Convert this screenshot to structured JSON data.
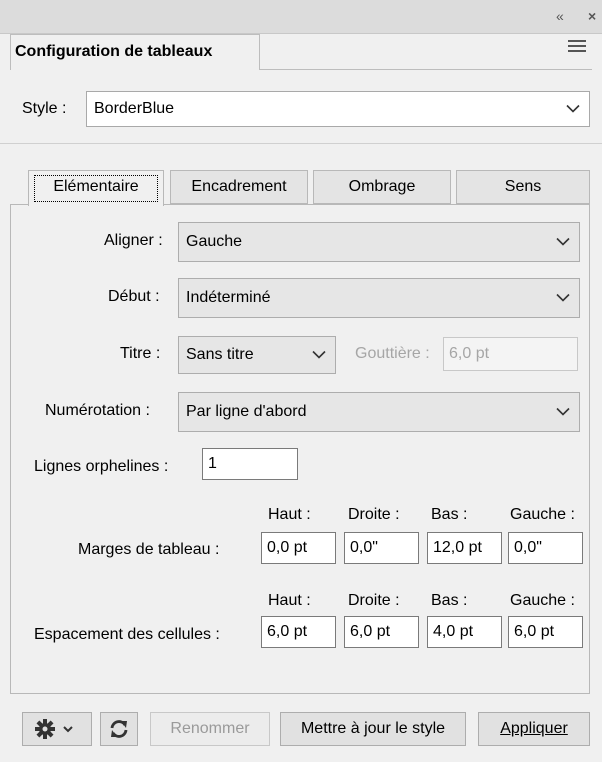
{
  "panel": {
    "title": "Configuration de tableaux"
  },
  "style_row": {
    "label": "Style :",
    "value": "BorderBlue"
  },
  "tabs": [
    {
      "label": "Elémentaire",
      "active": true
    },
    {
      "label": "Encadrement",
      "active": false
    },
    {
      "label": "Ombrage",
      "active": false
    },
    {
      "label": "Sens",
      "active": false
    }
  ],
  "fields": {
    "aligner": {
      "label": "Aligner :",
      "value": "Gauche"
    },
    "debut": {
      "label": "Début :",
      "value": "Indéterminé"
    },
    "titre": {
      "label": "Titre :",
      "value": "Sans titre"
    },
    "gouttiere": {
      "label": "Gouttière :",
      "value": "6,0 pt"
    },
    "numerotation": {
      "label": "Numérotation :",
      "value": "Par ligne d'abord"
    },
    "lignes_orphelines": {
      "label": "Lignes orphelines :",
      "value": "1"
    }
  },
  "margins": {
    "label": "Marges de tableau :",
    "headers": [
      "Haut :",
      "Droite :",
      "Bas :",
      "Gauche :"
    ],
    "values": [
      "0,0 pt",
      "0,0\"",
      "12,0 pt",
      "0,0\""
    ]
  },
  "spacing": {
    "label": "Espacement des cellules :",
    "headers": [
      "Haut :",
      "Droite :",
      "Bas :",
      "Gauche :"
    ],
    "values": [
      "6,0 pt",
      "6,0 pt",
      "4,0 pt",
      "6,0 pt"
    ]
  },
  "buttons": {
    "rename": "Renommer",
    "update_style": "Mettre à jour le style",
    "apply": "Appliquer"
  },
  "icons": {
    "collapse": "double-chevron-left-icon",
    "close": "close-icon",
    "menu": "hamburger-menu-icon",
    "gear": "gear-icon",
    "refresh": "refresh-icon"
  }
}
